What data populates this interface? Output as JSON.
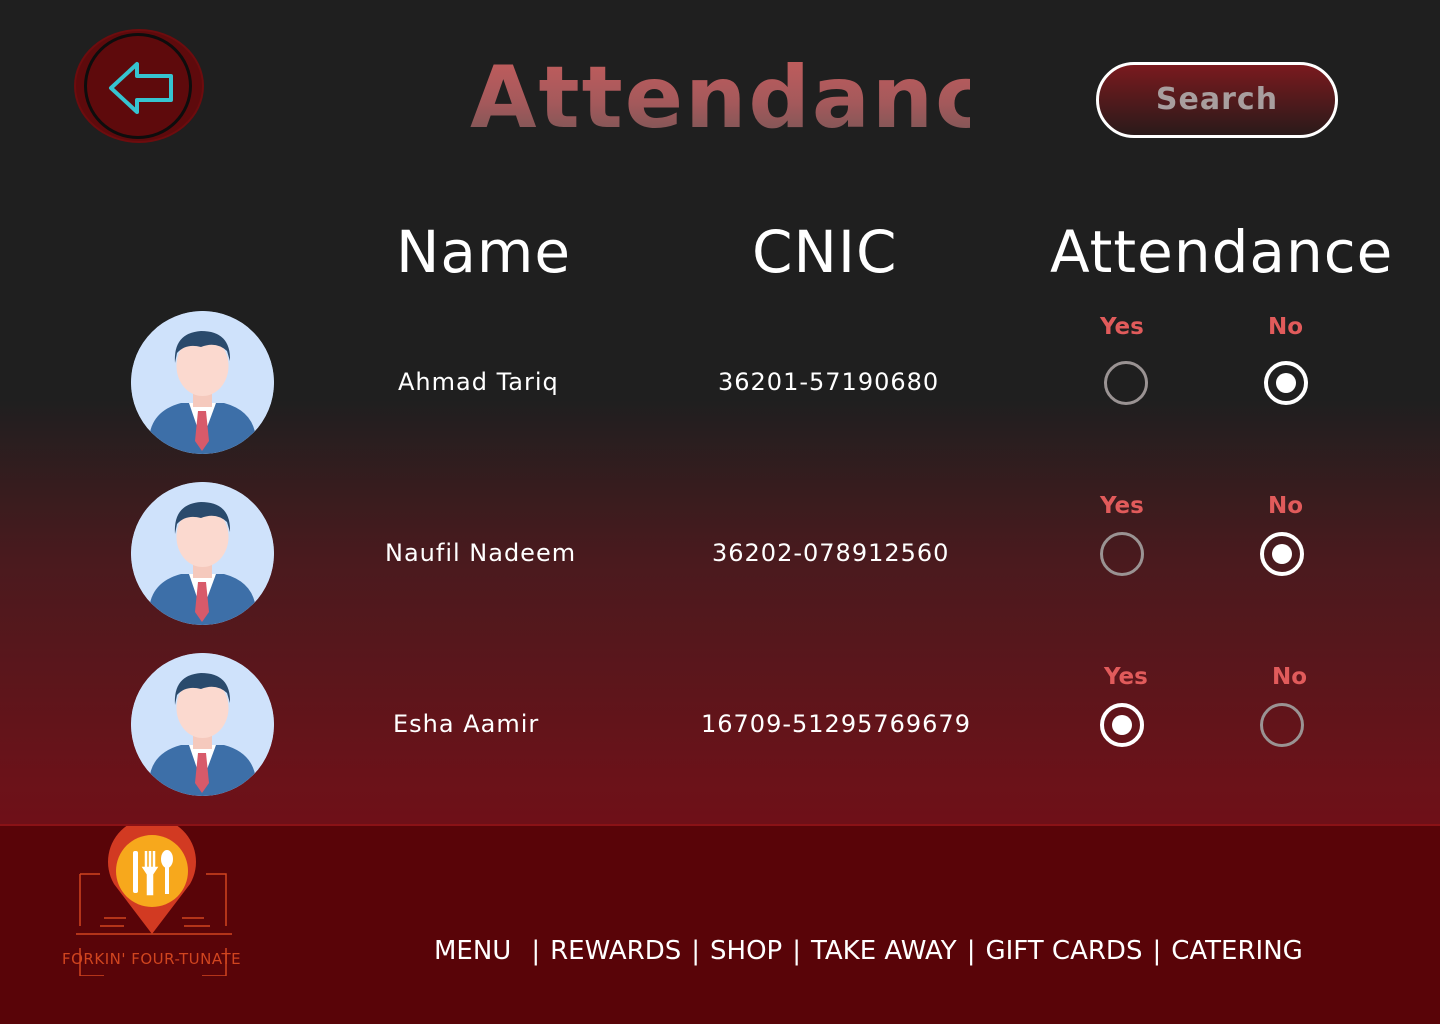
{
  "header": {
    "title": "Attendance",
    "search_label": "Search"
  },
  "columns": {
    "name": "Name",
    "cnic": "CNIC",
    "attendance": "Attendance"
  },
  "rows": [
    {
      "name": "Ahmad Tariq",
      "cnic": "36201-57190680",
      "yes_label": "Yes",
      "no_label": "No",
      "selected": "No"
    },
    {
      "name": "Naufil Nadeem",
      "cnic": "36202-078912560",
      "yes_label": "Yes",
      "no_label": "No",
      "selected": "No"
    },
    {
      "name": "Esha Aamir",
      "cnic": "16709-51295769679",
      "yes_label": "Yes",
      "no_label": "No",
      "selected": "Yes"
    }
  ],
  "footer": {
    "brand": "FORKIN' FOUR-TUNATE",
    "nav": [
      "MENU",
      "REWARDS",
      "SHOP",
      "TAKE AWAY",
      "GIFT CARDS",
      "CATERING"
    ]
  },
  "colors": {
    "accent": "#e15b5b",
    "footer_bg": "#590408",
    "back_icon": "#36c4d0"
  },
  "icons": {
    "back": "back-arrow-icon",
    "avatar": "person-avatar-icon",
    "logo": "fork-knife-spoon-pin-icon"
  }
}
